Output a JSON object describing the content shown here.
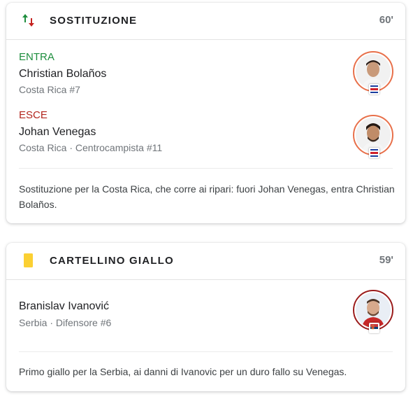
{
  "events": [
    {
      "title": "SOSTITUZIONE",
      "minute": "60'",
      "icon": "substitution-arrows-icon",
      "players_in": {
        "tag": "ENTRA",
        "name": "Christian Bolaños",
        "info": "Costa Rica #7",
        "flag": "costa-rica-flag-icon"
      },
      "players_out": {
        "tag": "ESCE",
        "name": "Johan Venegas",
        "info": "Costa Rica · Centrocampista #11",
        "flag": "costa-rica-flag-icon"
      },
      "comment": "Sostituzione per la Costa Rica, che corre ai ripari: fuori Johan Venegas, entra Christian Bolaños."
    },
    {
      "title": "CARTELLINO GIALLO",
      "minute": "59'",
      "icon": "yellow-card-icon",
      "player": {
        "name": "Branislav Ivanović",
        "info": "Serbia · Difensore #6",
        "flag": "serbia-flag-icon"
      },
      "comment": "Primo giallo per la Serbia, ai danni di Ivanovic per un duro fallo su Venegas."
    }
  ],
  "colors": {
    "in": "#1e8e3e",
    "out": "#b3261e",
    "yellow_card": "#fbd033",
    "muted": "#70757a"
  }
}
